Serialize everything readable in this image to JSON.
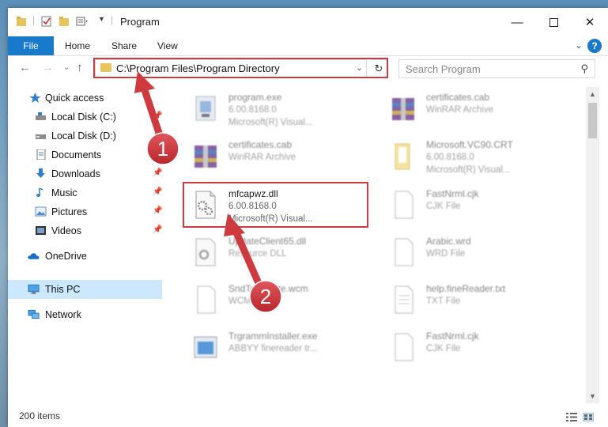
{
  "window": {
    "title": "Program"
  },
  "ribbon": {
    "tabs": [
      "File",
      "Home",
      "Share",
      "View"
    ],
    "help": "?"
  },
  "address": {
    "path": "C:\\Program Files\\Program Directory"
  },
  "search": {
    "placeholder": "Search Program"
  },
  "sidebar": {
    "items": [
      {
        "label": "Quick access",
        "icon": "star-icon"
      },
      {
        "label": "Local Disk (C:)",
        "icon": "drive-icon"
      },
      {
        "label": "Local Disk (D:)",
        "icon": "drive-icon"
      },
      {
        "label": "Documents",
        "icon": "documents-icon"
      },
      {
        "label": "Downloads",
        "icon": "download-icon"
      },
      {
        "label": "Music",
        "icon": "music-icon"
      },
      {
        "label": "Pictures",
        "icon": "pictures-icon"
      },
      {
        "label": "Videos",
        "icon": "videos-icon"
      },
      {
        "label": "OneDrive",
        "icon": "cloud-icon"
      },
      {
        "label": "This PC",
        "icon": "computer-icon"
      },
      {
        "label": "Network",
        "icon": "network-icon"
      }
    ]
  },
  "files": [
    {
      "name": "program.exe",
      "line2": "6.00.8168.0",
      "line3": "Microsoft(R) Visual..."
    },
    {
      "name": "certificates.cab",
      "line2": "WinRAR Archive",
      "line3": ""
    },
    {
      "name": "certificates.cab",
      "line2": "WinRAR Archive",
      "line3": ""
    },
    {
      "name": "Microsoft.VC90.CRT",
      "line2": "6.00.8168.0",
      "line3": "Microsoft(R) Visual..."
    },
    {
      "name": "mfcapwz.dll",
      "line2": "6.00.8168.0",
      "line3": "Microsoft(R) Visual..."
    },
    {
      "name": "FastNrml.cjk",
      "line2": "CJK File",
      "line3": ""
    },
    {
      "name": "UpdateClient65.dll",
      "line2": "Resource DLL",
      "line3": ""
    },
    {
      "name": "Arabic.wrd",
      "line2": "WRD File",
      "line3": ""
    },
    {
      "name": "SndToUpdate.wcm",
      "line2": "WCM File",
      "line3": ""
    },
    {
      "name": "help.fineReader.txt",
      "line2": "TXT File",
      "line3": ""
    },
    {
      "name": "TrgrammInstaller.exe",
      "line2": "ABBYY finereader tr...",
      "line3": ""
    },
    {
      "name": "FastNrml.cjk",
      "line2": "CJK File",
      "line3": ""
    }
  ],
  "status": {
    "count": "200 items"
  },
  "annotations": {
    "step1": "1",
    "step2": "2",
    "color": "#cf3a3f"
  }
}
